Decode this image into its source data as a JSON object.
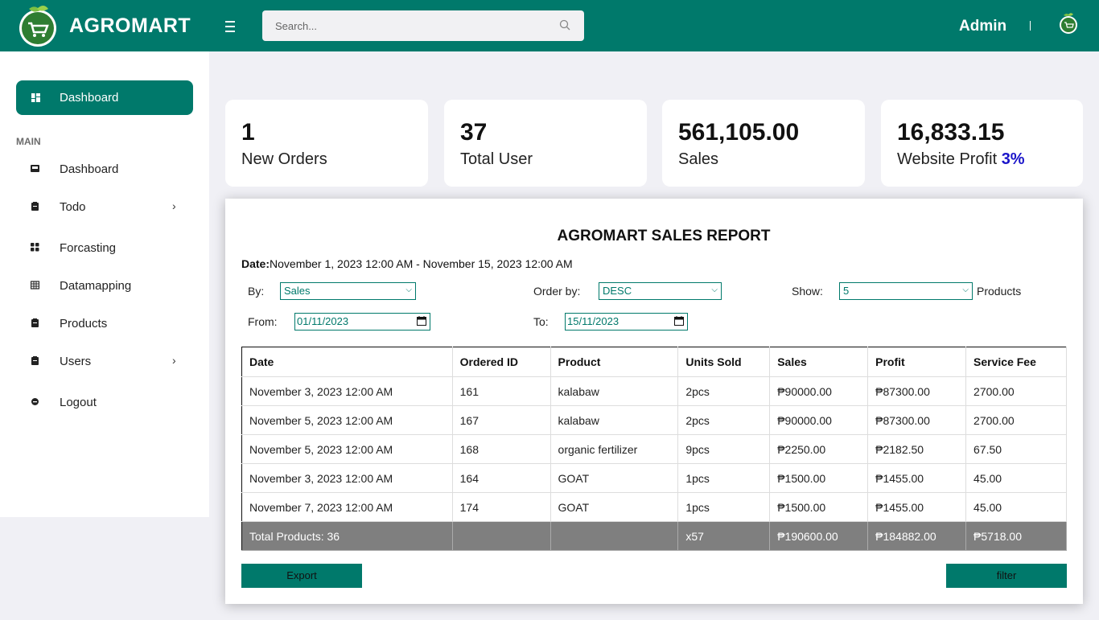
{
  "header": {
    "brand": "AGROMART",
    "search_placeholder": "Search...",
    "user": "Admin"
  },
  "sidebar": {
    "active_label": "Dashboard",
    "section_heading": "MAIN",
    "items": [
      {
        "label": "Dashboard",
        "icon": "inbox-icon"
      },
      {
        "label": "Todo",
        "icon": "clipboard-icon",
        "chevron": "›"
      },
      {
        "label": "Forcasting",
        "icon": "grid-dots-icon"
      },
      {
        "label": "Datamapping",
        "icon": "table-icon"
      },
      {
        "label": "Products",
        "icon": "clipboard-icon"
      },
      {
        "label": "Users",
        "icon": "clipboard-icon",
        "chevron": "›"
      },
      {
        "label": "Logout",
        "icon": "logout-icon"
      }
    ]
  },
  "cards": [
    {
      "value": "1",
      "caption": "New Orders"
    },
    {
      "value": "37",
      "caption": "Total User"
    },
    {
      "value": "561,105.00",
      "caption": "Sales"
    },
    {
      "value": "16,833.15",
      "caption": "Website Profit",
      "percent": "3%"
    }
  ],
  "report": {
    "title": "AGROMART SALES REPORT",
    "date_label": "Date:",
    "date_range": "November 1, 2023 12:00 AM - November 15, 2023 12:00 AM",
    "filters": {
      "by_label": "By:",
      "by_value": "Sales",
      "order_label": "Order by:",
      "order_value": "DESC",
      "show_label": "Show:",
      "show_value": "5",
      "show_suffix": "Products",
      "from_label": "From:",
      "from_value": "01/11/2023",
      "to_label": "To:",
      "to_value": "15/11/2023"
    },
    "columns": [
      "Date",
      "Ordered ID",
      "Product",
      "Units Sold",
      "Sales",
      "Profit",
      "Service Fee"
    ],
    "rows": [
      [
        "November 3, 2023 12:00 AM",
        "161",
        "kalabaw",
        "2pcs",
        "₱90000.00",
        "₱87300.00",
        "2700.00"
      ],
      [
        "November 5, 2023 12:00 AM",
        "167",
        "kalabaw",
        "2pcs",
        "₱90000.00",
        "₱87300.00",
        "2700.00"
      ],
      [
        "November 5, 2023 12:00 AM",
        "168",
        "organic fertilizer",
        "9pcs",
        "₱2250.00",
        "₱2182.50",
        "67.50"
      ],
      [
        "November 3, 2023 12:00 AM",
        "164",
        "GOAT",
        "1pcs",
        "₱1500.00",
        "₱1455.00",
        "45.00"
      ],
      [
        "November 7, 2023 12:00 AM",
        "174",
        "GOAT",
        "1pcs",
        "₱1500.00",
        "₱1455.00",
        "45.00"
      ]
    ],
    "total": [
      "Total Products: 36",
      "",
      "",
      "x57",
      "₱190600.00",
      "₱184882.00",
      "₱5718.00"
    ],
    "export_label": "Export",
    "filter_label": "filter"
  },
  "colors": {
    "brand": "#00796b",
    "percent": "#1a14c9",
    "total_row": "#7f7f7f"
  }
}
